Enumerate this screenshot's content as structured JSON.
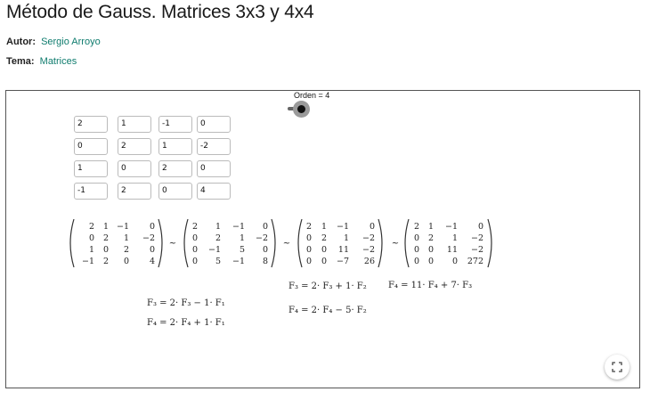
{
  "page": {
    "title": "Método de Gauss. Matrices 3x3 y 4x4",
    "author_label": "Autor:",
    "author": "Sergio Arroyo",
    "topic_label": "Tema:",
    "topic": "Matrices"
  },
  "applet": {
    "slider_label": "Orden = 4",
    "inputs": [
      [
        "2",
        "1",
        "-1",
        "0"
      ],
      [
        "0",
        "2",
        "1",
        "-2"
      ],
      [
        "1",
        "0",
        "2",
        "0"
      ],
      [
        "-1",
        "2",
        "0",
        "4"
      ]
    ],
    "matrices": [
      [
        [
          "2",
          "1",
          "−1",
          "0"
        ],
        [
          "0",
          "2",
          "1",
          "−2"
        ],
        [
          "1",
          "0",
          "2",
          "0"
        ],
        [
          "−1",
          "2",
          "0",
          "4"
        ]
      ],
      [
        [
          "2",
          "1",
          "−1",
          "0"
        ],
        [
          "0",
          "2",
          "1",
          "−2"
        ],
        [
          "0",
          "−1",
          "5",
          "0"
        ],
        [
          "0",
          "5",
          "−1",
          "8"
        ]
      ],
      [
        [
          "2",
          "1",
          "−1",
          "0"
        ],
        [
          "0",
          "2",
          "1",
          "−2"
        ],
        [
          "0",
          "0",
          "11",
          "−2"
        ],
        [
          "0",
          "0",
          "−7",
          "26"
        ]
      ],
      [
        [
          "2",
          "1",
          "−1",
          "0"
        ],
        [
          "0",
          "2",
          "1",
          "−2"
        ],
        [
          "0",
          "0",
          "11",
          "−2"
        ],
        [
          "0",
          "0",
          "0",
          "272"
        ]
      ]
    ],
    "tilde": "~",
    "operations": {
      "step1": [
        "F₃ = 2· F₃ − 1· F₁",
        "F₄ = 2· F₄ + 1· F₁"
      ],
      "step2": [
        "F₃ = 2· F₃ + 1· F₂",
        "F₄ = 2· F₄ − 5· F₂"
      ],
      "step3": [
        "F₄ = 11· F₄ + 7· F₃"
      ]
    }
  }
}
